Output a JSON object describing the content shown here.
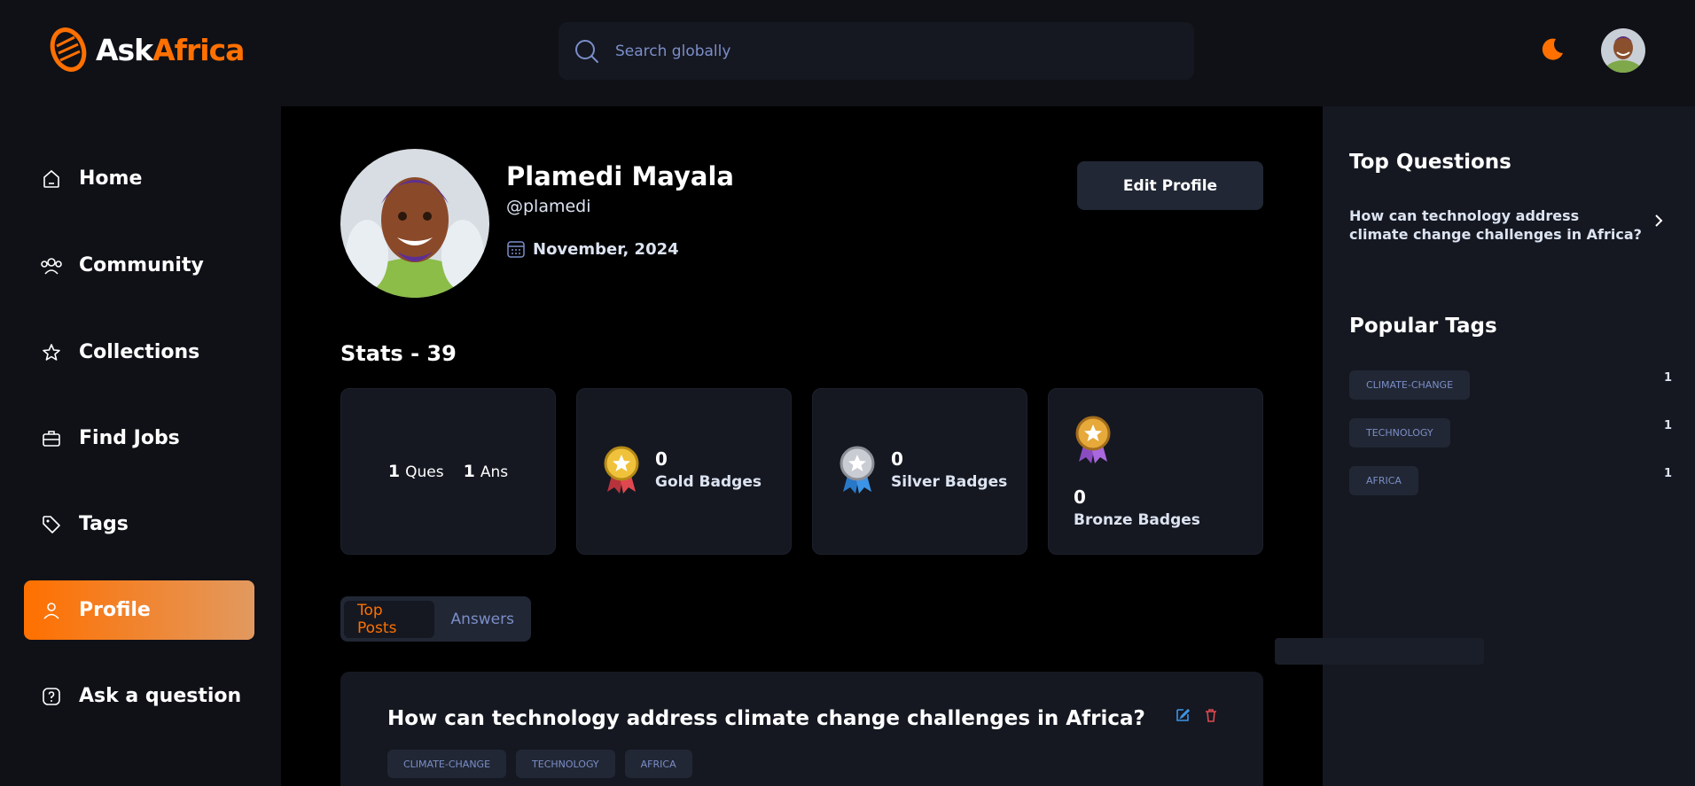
{
  "header": {
    "logo": {
      "part1": "Ask",
      "part2": "Africa"
    },
    "search": {
      "placeholder": "Search globally"
    }
  },
  "sidebar": {
    "items": [
      {
        "label": "Home",
        "icon": "home-icon"
      },
      {
        "label": "Community",
        "icon": "users-icon"
      },
      {
        "label": "Collections",
        "icon": "star-icon"
      },
      {
        "label": "Find Jobs",
        "icon": "briefcase-icon"
      },
      {
        "label": "Tags",
        "icon": "tag-icon"
      },
      {
        "label": "Profile",
        "icon": "user-icon",
        "active": true
      },
      {
        "label": "Ask a question",
        "icon": "question-icon"
      }
    ]
  },
  "profile": {
    "name": "Plamedi Mayala",
    "handle": "@plamedi",
    "joined": "November, 2024",
    "edit_label": "Edit Profile"
  },
  "stats": {
    "title": "Stats - 39",
    "questions": "1",
    "questions_label": "Ques",
    "answers": "1",
    "answers_label": "Ans",
    "gold": {
      "value": "0",
      "label": "Gold Badges"
    },
    "silver": {
      "value": "0",
      "label": "Silver Badges"
    },
    "bronze": {
      "value": "0",
      "label": "Bronze Badges"
    }
  },
  "tabs": [
    {
      "label": "Top Posts",
      "active": true
    },
    {
      "label": "Answers"
    }
  ],
  "post": {
    "title": "How can technology address climate change challenges in Africa?",
    "tags": [
      "CLIMATE-CHANGE",
      "TECHNOLOGY",
      "AFRICA"
    ]
  },
  "rightbar": {
    "top_questions_title": "Top Questions",
    "top_question": "How can technology address climate change challenges in Africa?",
    "popular_tags_title": "Popular Tags",
    "popular_tags": [
      {
        "name": "CLIMATE-CHANGE",
        "count": "1"
      },
      {
        "name": "TECHNOLOGY",
        "count": "1"
      },
      {
        "name": "AFRICA",
        "count": "1"
      }
    ]
  },
  "colors": {
    "accent": "#ff7000",
    "background": "#0f1117",
    "card": "#151821",
    "tag_text": "#7b8ec8"
  }
}
